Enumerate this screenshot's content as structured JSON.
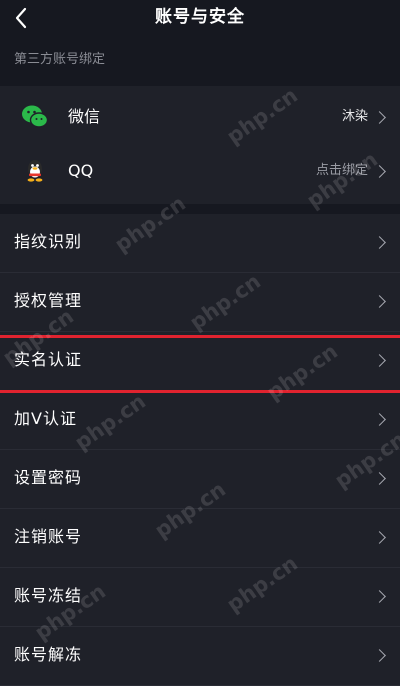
{
  "header": {
    "title": "账号与安全",
    "back_icon": "chevron-left-icon"
  },
  "third_party": {
    "section_label": "第三方账号绑定",
    "items": [
      {
        "name": "微信",
        "value": "沐染",
        "icon": "wechat-icon",
        "color": "#2bb94a"
      },
      {
        "name": "QQ",
        "value": "点击绑定",
        "icon": "qq-penguin-icon",
        "color": "#e8372c"
      }
    ]
  },
  "settings": {
    "items": [
      {
        "label": "指纹识别"
      },
      {
        "label": "授权管理"
      },
      {
        "label": "实名认证"
      },
      {
        "label": "加V认证"
      },
      {
        "label": "设置密码"
      },
      {
        "label": "注销账号"
      },
      {
        "label": "账号冻结"
      },
      {
        "label": "账号解冻"
      }
    ]
  },
  "annotation": {
    "highlight_color": "#e0232f",
    "highlighted_item": "实名认证"
  },
  "watermark": {
    "text": "php.cn"
  }
}
